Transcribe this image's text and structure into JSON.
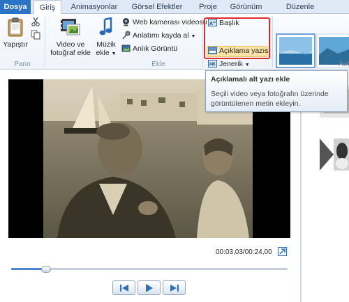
{
  "tabs": {
    "file": "Dosya",
    "home": "Giriş",
    "animations": "Animasyonlar",
    "visual_effects": "Görsel Efektler",
    "project": "Proje",
    "view": "Görünüm",
    "edit": "Düzenle"
  },
  "ribbon": {
    "clipboard": {
      "paste": "Yapıştır",
      "group_label": "Pano"
    },
    "add": {
      "video_photo_line1": "Video ve",
      "video_photo_line2": "fotoğraf ekle",
      "music_line1": "Müzik",
      "music_line2": "ekle",
      "webcam": "Web kamerası videosu",
      "narration": "Anlatımı kayda al",
      "snapshot": "Anlık Görüntü",
      "group_label": "Ekle"
    },
    "text": {
      "title": "Başlık",
      "caption": "Açıklama yazısı",
      "credits": "Jenerik"
    },
    "themes": {
      "group_label_partial": "Aut"
    }
  },
  "tooltip": {
    "title": "Açıklamalı alt yazı ekle",
    "body": "Seçili video veya fotoğrafın üzerinde görüntülenen metin ekleyin."
  },
  "player": {
    "timecode": "00:03,03/00:24,00",
    "progress_fraction": 0.126
  },
  "colors": {
    "file_tab": "#2a73c5",
    "highlight_box": "#e02b2b",
    "hover": "#fbe4a6"
  }
}
